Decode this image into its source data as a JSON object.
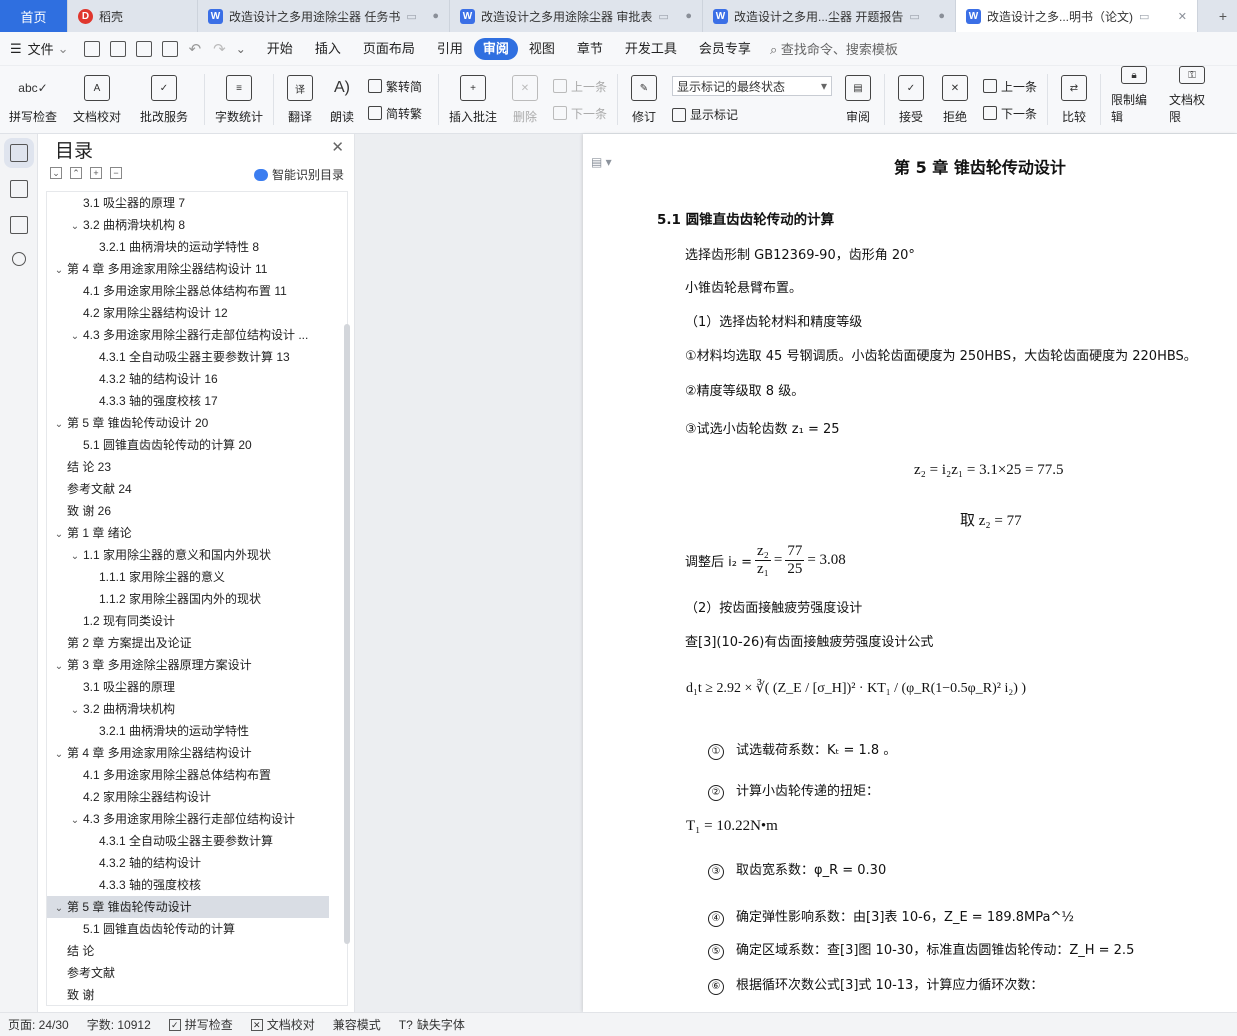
{
  "tabs": [
    {
      "label": "首页"
    },
    {
      "label": "稻壳"
    },
    {
      "label": "改造设计之多用途除尘器 任务书"
    },
    {
      "label": "改造设计之多用途除尘器 审批表"
    },
    {
      "label": "改造设计之多用...尘器 开题报告"
    },
    {
      "label": "改造设计之多...明书（论文)"
    }
  ],
  "menu": {
    "file": "文件",
    "items": [
      "开始",
      "插入",
      "页面布局",
      "引用",
      "审阅",
      "视图",
      "章节",
      "开发工具",
      "会员专享"
    ],
    "active": "审阅",
    "search": "查找命令、搜索模板"
  },
  "ribbon": {
    "spell": "拼写检查",
    "doc_check": "文档校对",
    "batch": "批改服务",
    "word_count": "字数统计",
    "translate": "翻译",
    "read": "朗读",
    "trad": "繁转简",
    "simp": "简转繁",
    "insert_comment": "插入批注",
    "delete": "删除",
    "prev": "上一条",
    "next": "下一条",
    "revise": "修订",
    "display_state": "显示标记的最终状态",
    "show_marks": "显示标记",
    "review": "审阅",
    "accept": "接受",
    "reject": "拒绝",
    "prev2": "上一条",
    "next2": "下一条",
    "compare": "比较",
    "restrict": "限制编辑",
    "rights": "文档权限"
  },
  "toc": {
    "title": "目录",
    "smart": "智能识别目录",
    "items": [
      {
        "label": "3.1 吸尘器的原理  7",
        "level": 2,
        "arrow": ""
      },
      {
        "label": "3.2  曲柄滑块机构  8",
        "level": 2,
        "arrow": "v"
      },
      {
        "label": "3.2.1 曲柄滑块的运动学特性  8",
        "level": 3,
        "arrow": ""
      },
      {
        "label": "第 4 章  多用途家用除尘器结构设计  11",
        "level": 1,
        "arrow": "v"
      },
      {
        "label": "4.1  多用途家用除尘器总体结构布置  11",
        "level": 2,
        "arrow": ""
      },
      {
        "label": "4.2 家用除尘器结构设计  12",
        "level": 2,
        "arrow": ""
      },
      {
        "label": "4.3 多用途家用除尘器行走部位结构设计  ...",
        "level": 2,
        "arrow": "v"
      },
      {
        "label": "4.3.1 全自动吸尘器主要参数计算  13",
        "level": 3,
        "arrow": ""
      },
      {
        "label": "4.3.2 轴的结构设计  16",
        "level": 3,
        "arrow": ""
      },
      {
        "label": "4.3.3 轴的强度校核  17",
        "level": 3,
        "arrow": ""
      },
      {
        "label": "第 5 章  锥齿轮传动设计  20",
        "level": 1,
        "arrow": "v"
      },
      {
        "label": "5.1 圆锥直齿齿轮传动的计算  20",
        "level": 2,
        "arrow": ""
      },
      {
        "label": "结   论  23",
        "level": 1,
        "arrow": ""
      },
      {
        "label": "参考文献  24",
        "level": 1,
        "arrow": ""
      },
      {
        "label": "致   谢  26",
        "level": 1,
        "arrow": ""
      },
      {
        "label": "第 1 章  绪论",
        "level": 1,
        "arrow": "v"
      },
      {
        "label": "1.1 家用除尘器的意义和国内外现状",
        "level": 2,
        "arrow": "v"
      },
      {
        "label": "1.1.1 家用除尘器的意义",
        "level": 3,
        "arrow": ""
      },
      {
        "label": "1.1.2 家用除尘器国内外的现状",
        "level": 3,
        "arrow": ""
      },
      {
        "label": "1.2 现有同类设计",
        "level": 2,
        "arrow": ""
      },
      {
        "label": "第 2 章  方案提出及论证",
        "level": 1,
        "arrow": ""
      },
      {
        "label": "第 3 章  多用途除尘器原理方案设计",
        "level": 1,
        "arrow": "v"
      },
      {
        "label": "3.1 吸尘器的原理",
        "level": 2,
        "arrow": ""
      },
      {
        "label": "3.2  曲柄滑块机构",
        "level": 2,
        "arrow": "v"
      },
      {
        "label": "3.2.1 曲柄滑块的运动学特性",
        "level": 3,
        "arrow": ""
      },
      {
        "label": "第 4 章  多用途家用除尘器结构设计",
        "level": 1,
        "arrow": "v"
      },
      {
        "label": "4.1  多用途家用除尘器总体结构布置",
        "level": 2,
        "arrow": ""
      },
      {
        "label": "4.2 家用除尘器结构设计",
        "level": 2,
        "arrow": ""
      },
      {
        "label": "4.3 多用途家用除尘器行走部位结构设计",
        "level": 2,
        "arrow": "v"
      },
      {
        "label": "4.3.1 全自动吸尘器主要参数计算",
        "level": 3,
        "arrow": ""
      },
      {
        "label": "4.3.2 轴的结构设计",
        "level": 3,
        "arrow": ""
      },
      {
        "label": "4.3.3 轴的强度校核",
        "level": 3,
        "arrow": ""
      },
      {
        "label": "第 5 章  锥齿轮传动设计",
        "level": 1,
        "arrow": "v",
        "selected": true
      },
      {
        "label": "5.1 圆锥直齿齿轮传动的计算",
        "level": 2,
        "arrow": ""
      },
      {
        "label": "结   论",
        "level": 1,
        "arrow": ""
      },
      {
        "label": "参考文献",
        "level": 1,
        "arrow": ""
      },
      {
        "label": "致   谢",
        "level": 1,
        "arrow": ""
      }
    ]
  },
  "doc": {
    "chapter_title": "第 5 章  锥齿轮传动设计",
    "section_title": "5.1 圆锥直齿齿轮传动的计算",
    "p1": "选择齿形制 GB12369-90，齿形角 20°",
    "p2": "小锥齿轮悬臂布置。",
    "p3": "（1）选择齿轮材料和精度等级",
    "p4": "①材料均选取 45 号钢调质。小齿轮齿面硬度为 250HBS，大齿轮齿面硬度为 220HBS。",
    "p5": "②精度等级取 8 级。",
    "p6": "③试选小齿轮齿数 z₁ = 25",
    "eq1": "z₂ = i₂z₁ = 3.1×25 = 77.5",
    "eq2": "取 z₂ = 77",
    "adjust_prefix": "调整后 i₂ =",
    "frac1_num": "z₂",
    "frac1_den": "z₁",
    "frac2_num": "77",
    "frac2_den": "25",
    "adjust_result": "= 3.08",
    "p7": "（2）按齿面接触疲劳强度设计",
    "p8": "查[3](10-26)有齿面接触疲劳强度设计公式",
    "eq3": "d₁t ≥ 2.92 × ∛( (Z_E / [σ_H])² · KT₁ / (φ_R(1−0.5φ_R)² i₂) )",
    "s1": "试选载荷系数：Kₜ = 1.8 。",
    "s2": "计算小齿轮传递的扭矩：",
    "eq4": "T₁ = 10.22N•m",
    "s3": "取齿宽系数：φ_R = 0.30",
    "s4": "确定弹性影响系数：由[3]表 10-6，Z_E = 189.8MPa^½",
    "s5": "确定区域系数：查[3]图 10-30，标准直齿圆锥齿轮传动：Z_H = 2.5",
    "s6": "根据循环次数公式[3]式 10-13，计算应力循环次数：",
    "n1": "①",
    "n2": "②",
    "n3": "③",
    "n4": "④",
    "n5": "⑤",
    "n6": "⑥"
  },
  "status": {
    "page": "页面: 24/30",
    "words": "字数: 10912",
    "spell": "拼写检查",
    "doccheck": "文档校对",
    "compat": "兼容模式",
    "missing_font": "缺失字体"
  }
}
